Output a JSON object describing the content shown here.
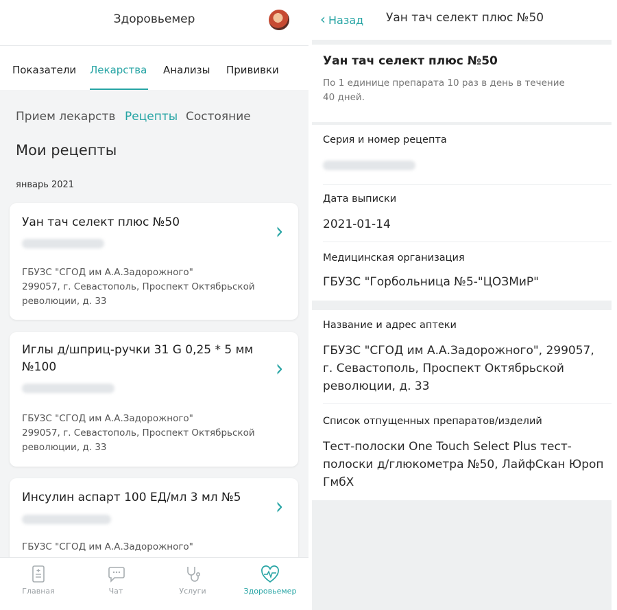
{
  "left": {
    "header": {
      "title": "Здоровьемер"
    },
    "main_tabs": [
      "Показатели",
      "Лекарства",
      "Анализы",
      "Прививки"
    ],
    "sub_tabs": [
      "Прием лекарств",
      "Рецепты",
      "Состояние"
    ],
    "section_title": "Мои рецепты",
    "month": "январь 2021",
    "cards": [
      {
        "title": "Уан тач селект плюс №50",
        "address": "ГБУЗС \"СГОД им А.А.Задорожного\"\n 299057, г. Севастополь, Проспект Октябрьской революции, д. 33"
      },
      {
        "title": "Иглы д/шприц-ручки 31 G 0,25 * 5 мм №100",
        "address": "ГБУЗС \"СГОД им А.А.Задорожного\"\n 299057, г. Севастополь, Проспект Октябрьской революции, д. 33"
      },
      {
        "title": "Инсулин аспарт 100 ЕД/мл 3 мл №5",
        "address": "ГБУЗС \"СГОД им А.А.Задорожного\""
      }
    ],
    "bottom_nav": [
      {
        "label": "Главная",
        "icon": "document-icon"
      },
      {
        "label": "Чат",
        "icon": "chat-icon"
      },
      {
        "label": "Услуги",
        "icon": "stethoscope-icon"
      },
      {
        "label": "Здоровьемер",
        "icon": "heart-pulse-icon"
      }
    ]
  },
  "right": {
    "back_label": "Назад",
    "title": "Уан тач селект плюс №50",
    "product": {
      "name": "Уан тач селект плюс №50",
      "dosage": "По 1 единице препарата 10 раз в день в течение 40 дней."
    },
    "fields": {
      "series_label": "Серия и номер рецепта",
      "date_label": "Дата выписки",
      "date_value": "2021-01-14",
      "org_label": "Медицинская организация",
      "org_value": "ГБУЗС \"Горбольница №5-\"ЦОЗМиР\"",
      "pharmacy_label": "Название и адрес аптеки",
      "pharmacy_value": "ГБУЗС \"СГОД им А.А.Задорожного\",  299057, г. Севастополь, Проспект Октябрьской революции, д. 33",
      "dispensed_label": "Список отпущенных препаратов/изделий",
      "dispensed_value": "Тест-полоски One Touch Select Plus тест-полоски д/глюкометра №50, ЛайфСкан Юроп ГмбХ"
    }
  },
  "colors": {
    "accent": "#26a4a4",
    "background": "#f3f4f5"
  }
}
